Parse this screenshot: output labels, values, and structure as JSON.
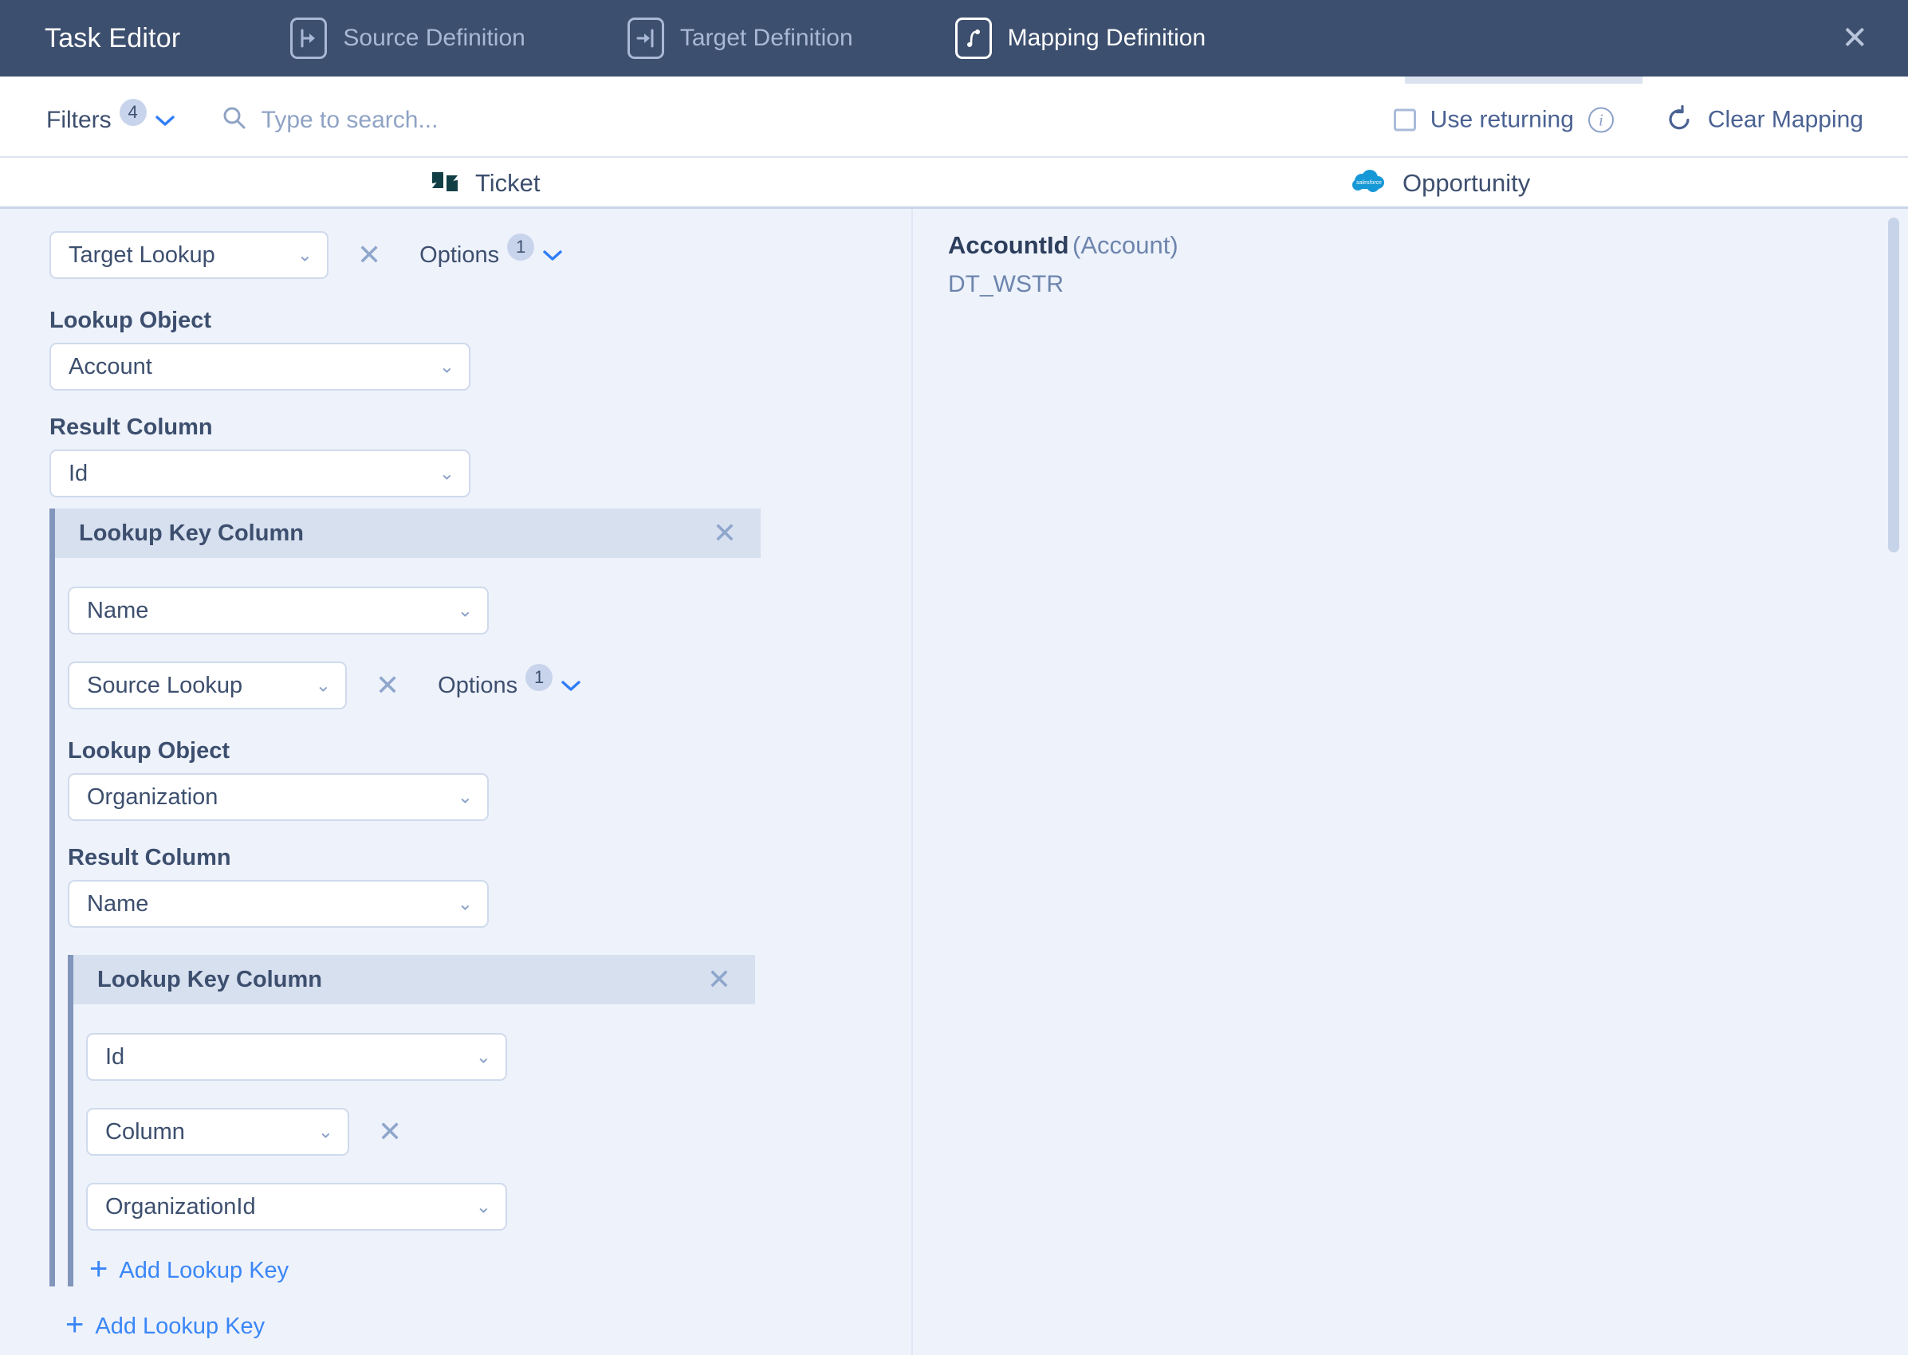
{
  "titlebar": {
    "app_title": "Task Editor",
    "close_label": "✕",
    "tabs": [
      {
        "label": "Source Definition",
        "icon": "source-definition-icon",
        "active": false
      },
      {
        "label": "Target Definition",
        "icon": "target-definition-icon",
        "active": false
      },
      {
        "label": "Mapping Definition",
        "icon": "mapping-definition-icon",
        "active": true
      }
    ]
  },
  "toolbar": {
    "filters_label": "Filters",
    "filters_count": "4",
    "filters_caret": "⌄",
    "search_placeholder": "Type to search...",
    "search_value": "",
    "search_icon": "search-icon",
    "use_returning_label": "Use returning",
    "use_returning_checked": false,
    "info_label": "i",
    "clear_mapping_label": "Clear Mapping",
    "clear_mapping_icon": "undo-icon"
  },
  "columns": {
    "source": {
      "label": "Ticket",
      "icon": "zendesk-logo"
    },
    "target": {
      "label": "Opportunity",
      "icon": "salesforce-logo"
    }
  },
  "mapping": {
    "level1": {
      "type_select": "Target Lookup",
      "remove_label": "✕",
      "options_label": "Options",
      "options_count": "1",
      "options_caret": "⌄",
      "lookup_object_label": "Lookup Object",
      "lookup_object_value": "Account",
      "result_column_label": "Result Column",
      "result_column_value": "Id"
    },
    "level2": {
      "panel_title": "Lookup Key Column",
      "panel_close": "✕",
      "key_column_value": "Name",
      "type_select": "Source Lookup",
      "remove_label": "✕",
      "options_label": "Options",
      "options_count": "1",
      "options_caret": "⌄",
      "lookup_object_label": "Lookup Object",
      "lookup_object_value": "Organization",
      "result_column_label": "Result Column",
      "result_column_value": "Name"
    },
    "level3": {
      "panel_title": "Lookup Key Column",
      "panel_close": "✕",
      "key_column_value": "Id",
      "type_select": "Column",
      "remove_label": "✕",
      "column_value": "OrganizationId",
      "add_lookup_key_label": "Add Lookup Key"
    },
    "add_lookup_key_label": "Add Lookup Key",
    "caret": "⌄"
  },
  "target_field": {
    "name": "AccountId",
    "object": "(Account)",
    "datatype": "DT_WSTR"
  },
  "colors": {
    "titlebar_bg": "#3d4f6e",
    "body_bg": "#eef2fb",
    "accent_blue": "#3a86f7",
    "panel_header_bg": "#d7e0ef",
    "panel_border": "#8296bb",
    "text_dark": "#3d4f6e",
    "text_muted": "#6d85ad"
  }
}
